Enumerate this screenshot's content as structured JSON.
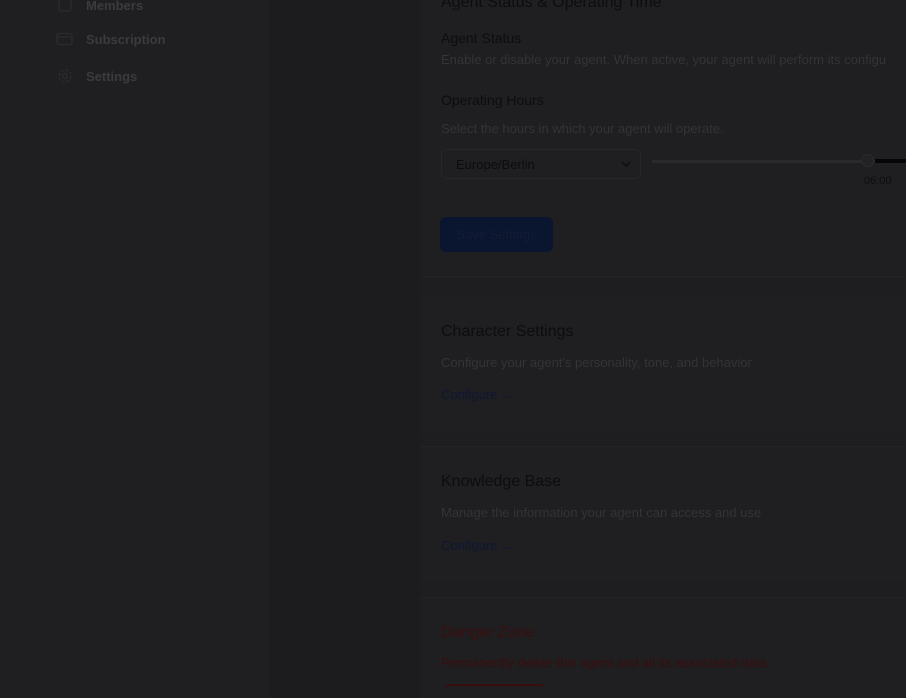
{
  "sidebar": {
    "items": [
      {
        "label": "Members",
        "icon": "members-icon"
      },
      {
        "label": "Subscription",
        "icon": "credit-card-icon"
      },
      {
        "label": "Settings",
        "icon": "gear-icon"
      }
    ]
  },
  "status_section": {
    "title": "Agent Status & Operating Time",
    "agent_status_label": "Agent Status",
    "agent_status_desc": "Enable or disable your agent. When active, your agent will perform its configu",
    "operating_hours_label": "Operating Hours",
    "operating_hours_desc": "Select the hours in which your agent will operate.",
    "timezone_value": "Europe/Berlin",
    "slider_value_text": "06:00",
    "save_label": "Save Settings"
  },
  "character_section": {
    "title": "Character Settings",
    "desc": "Configure your agent's personality, tone, and behavior",
    "link": "Configure →"
  },
  "knowledge_section": {
    "title": "Knowledge Base",
    "desc": "Manage the information your agent can access and use",
    "link": "Configure →"
  },
  "danger_section": {
    "title": "Danger Zone",
    "desc": "Permanently delete this agent and all its associated data."
  },
  "colors": {
    "overlay_bg": "#1e1e20",
    "primary_button": "#0a1530",
    "danger": "#3a0d0d"
  }
}
